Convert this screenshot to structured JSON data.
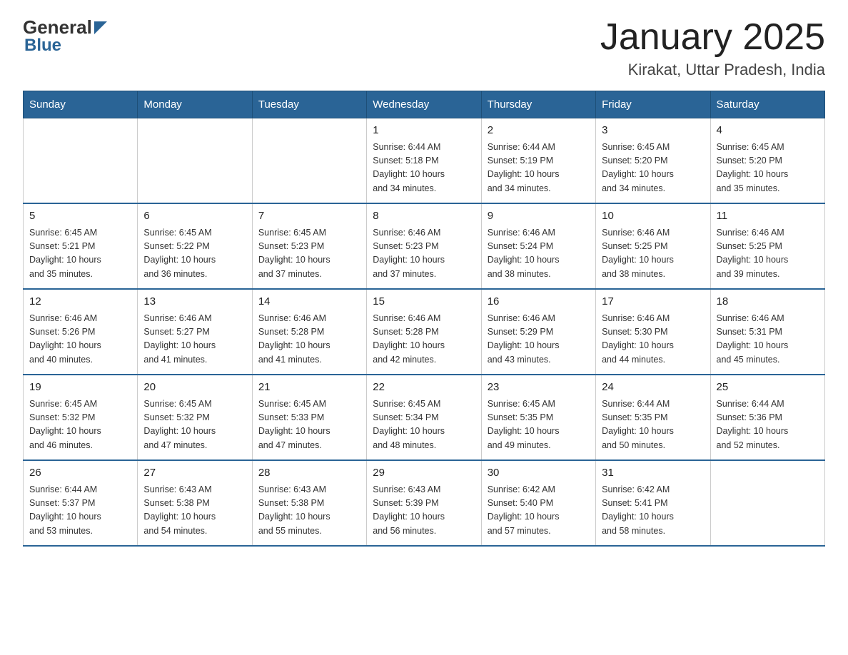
{
  "header": {
    "title": "January 2025",
    "subtitle": "Kirakat, Uttar Pradesh, India",
    "logo_general": "General",
    "logo_blue": "Blue"
  },
  "days": [
    "Sunday",
    "Monday",
    "Tuesday",
    "Wednesday",
    "Thursday",
    "Friday",
    "Saturday"
  ],
  "weeks": [
    [
      {
        "day": "",
        "info": ""
      },
      {
        "day": "",
        "info": ""
      },
      {
        "day": "",
        "info": ""
      },
      {
        "day": "1",
        "info": "Sunrise: 6:44 AM\nSunset: 5:18 PM\nDaylight: 10 hours\nand 34 minutes."
      },
      {
        "day": "2",
        "info": "Sunrise: 6:44 AM\nSunset: 5:19 PM\nDaylight: 10 hours\nand 34 minutes."
      },
      {
        "day": "3",
        "info": "Sunrise: 6:45 AM\nSunset: 5:20 PM\nDaylight: 10 hours\nand 34 minutes."
      },
      {
        "day": "4",
        "info": "Sunrise: 6:45 AM\nSunset: 5:20 PM\nDaylight: 10 hours\nand 35 minutes."
      }
    ],
    [
      {
        "day": "5",
        "info": "Sunrise: 6:45 AM\nSunset: 5:21 PM\nDaylight: 10 hours\nand 35 minutes."
      },
      {
        "day": "6",
        "info": "Sunrise: 6:45 AM\nSunset: 5:22 PM\nDaylight: 10 hours\nand 36 minutes."
      },
      {
        "day": "7",
        "info": "Sunrise: 6:45 AM\nSunset: 5:23 PM\nDaylight: 10 hours\nand 37 minutes."
      },
      {
        "day": "8",
        "info": "Sunrise: 6:46 AM\nSunset: 5:23 PM\nDaylight: 10 hours\nand 37 minutes."
      },
      {
        "day": "9",
        "info": "Sunrise: 6:46 AM\nSunset: 5:24 PM\nDaylight: 10 hours\nand 38 minutes."
      },
      {
        "day": "10",
        "info": "Sunrise: 6:46 AM\nSunset: 5:25 PM\nDaylight: 10 hours\nand 38 minutes."
      },
      {
        "day": "11",
        "info": "Sunrise: 6:46 AM\nSunset: 5:25 PM\nDaylight: 10 hours\nand 39 minutes."
      }
    ],
    [
      {
        "day": "12",
        "info": "Sunrise: 6:46 AM\nSunset: 5:26 PM\nDaylight: 10 hours\nand 40 minutes."
      },
      {
        "day": "13",
        "info": "Sunrise: 6:46 AM\nSunset: 5:27 PM\nDaylight: 10 hours\nand 41 minutes."
      },
      {
        "day": "14",
        "info": "Sunrise: 6:46 AM\nSunset: 5:28 PM\nDaylight: 10 hours\nand 41 minutes."
      },
      {
        "day": "15",
        "info": "Sunrise: 6:46 AM\nSunset: 5:28 PM\nDaylight: 10 hours\nand 42 minutes."
      },
      {
        "day": "16",
        "info": "Sunrise: 6:46 AM\nSunset: 5:29 PM\nDaylight: 10 hours\nand 43 minutes."
      },
      {
        "day": "17",
        "info": "Sunrise: 6:46 AM\nSunset: 5:30 PM\nDaylight: 10 hours\nand 44 minutes."
      },
      {
        "day": "18",
        "info": "Sunrise: 6:46 AM\nSunset: 5:31 PM\nDaylight: 10 hours\nand 45 minutes."
      }
    ],
    [
      {
        "day": "19",
        "info": "Sunrise: 6:45 AM\nSunset: 5:32 PM\nDaylight: 10 hours\nand 46 minutes."
      },
      {
        "day": "20",
        "info": "Sunrise: 6:45 AM\nSunset: 5:32 PM\nDaylight: 10 hours\nand 47 minutes."
      },
      {
        "day": "21",
        "info": "Sunrise: 6:45 AM\nSunset: 5:33 PM\nDaylight: 10 hours\nand 47 minutes."
      },
      {
        "day": "22",
        "info": "Sunrise: 6:45 AM\nSunset: 5:34 PM\nDaylight: 10 hours\nand 48 minutes."
      },
      {
        "day": "23",
        "info": "Sunrise: 6:45 AM\nSunset: 5:35 PM\nDaylight: 10 hours\nand 49 minutes."
      },
      {
        "day": "24",
        "info": "Sunrise: 6:44 AM\nSunset: 5:35 PM\nDaylight: 10 hours\nand 50 minutes."
      },
      {
        "day": "25",
        "info": "Sunrise: 6:44 AM\nSunset: 5:36 PM\nDaylight: 10 hours\nand 52 minutes."
      }
    ],
    [
      {
        "day": "26",
        "info": "Sunrise: 6:44 AM\nSunset: 5:37 PM\nDaylight: 10 hours\nand 53 minutes."
      },
      {
        "day": "27",
        "info": "Sunrise: 6:43 AM\nSunset: 5:38 PM\nDaylight: 10 hours\nand 54 minutes."
      },
      {
        "day": "28",
        "info": "Sunrise: 6:43 AM\nSunset: 5:38 PM\nDaylight: 10 hours\nand 55 minutes."
      },
      {
        "day": "29",
        "info": "Sunrise: 6:43 AM\nSunset: 5:39 PM\nDaylight: 10 hours\nand 56 minutes."
      },
      {
        "day": "30",
        "info": "Sunrise: 6:42 AM\nSunset: 5:40 PM\nDaylight: 10 hours\nand 57 minutes."
      },
      {
        "day": "31",
        "info": "Sunrise: 6:42 AM\nSunset: 5:41 PM\nDaylight: 10 hours\nand 58 minutes."
      },
      {
        "day": "",
        "info": ""
      }
    ]
  ],
  "accent_color": "#2a6496"
}
